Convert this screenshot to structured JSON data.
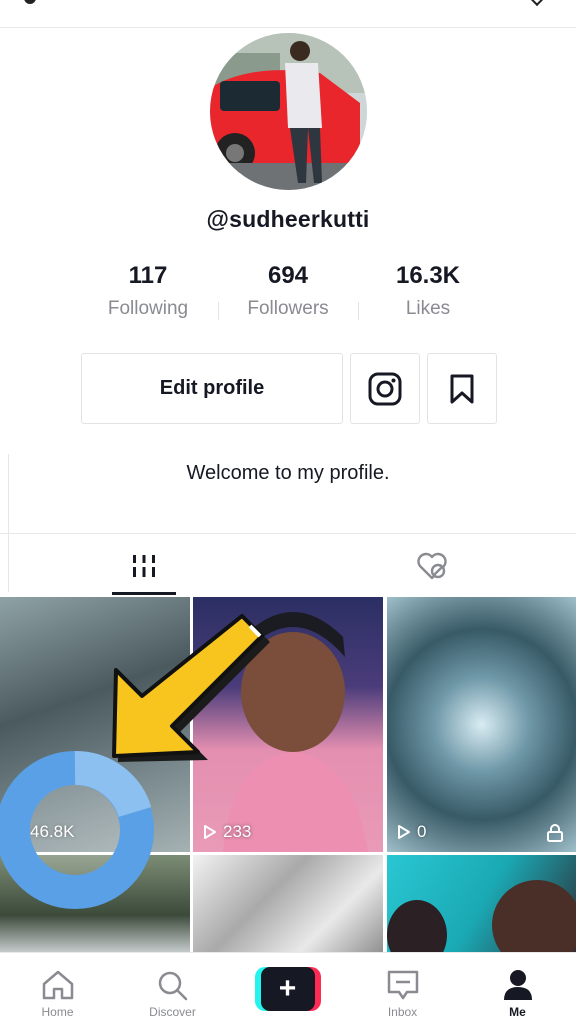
{
  "profile": {
    "username": "@sudheerkutti",
    "bio": "Welcome to my profile.",
    "avatar_icon": "profile-photo"
  },
  "stats": [
    {
      "value": "117",
      "label": "Following"
    },
    {
      "value": "694",
      "label": "Followers"
    },
    {
      "value": "16.3K",
      "label": "Likes"
    }
  ],
  "actions": {
    "edit_profile": "Edit profile",
    "instagram_icon": "instagram-icon",
    "bookmark_icon": "bookmark-icon"
  },
  "tabs": [
    {
      "icon": "videos-grid-icon",
      "active": true
    },
    {
      "icon": "liked-heart-icon",
      "active": false
    }
  ],
  "videos": [
    {
      "views": "46.8K",
      "private": false
    },
    {
      "views": "233",
      "private": false
    },
    {
      "views": "0",
      "private": true
    },
    {
      "views": "",
      "private": false
    },
    {
      "views": "",
      "private": false
    },
    {
      "views": "",
      "private": false
    }
  ],
  "bottom_nav": [
    {
      "label": "Home",
      "icon": "home-icon"
    },
    {
      "label": "Discover",
      "icon": "search-icon"
    },
    {
      "label": "",
      "icon": "create-plus-icon"
    },
    {
      "label": "Inbox",
      "icon": "inbox-icon"
    },
    {
      "label": "Me",
      "icon": "profile-icon",
      "active": true
    }
  ],
  "colors": {
    "accent_cyan": "#25f4ee",
    "accent_red": "#fe2c55",
    "arrow_yellow": "#f7c51e",
    "ring_blue": "#5aa0e6"
  }
}
